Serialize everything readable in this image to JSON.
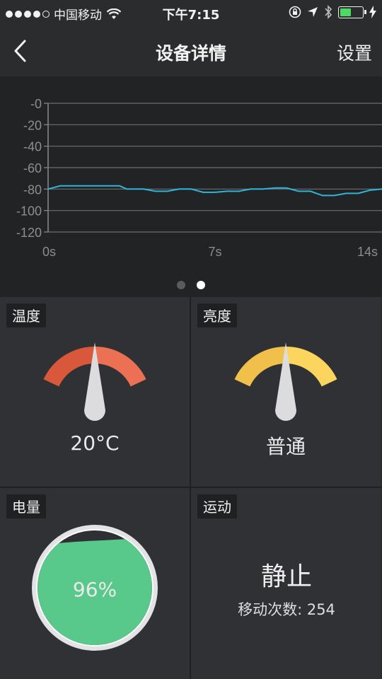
{
  "status_bar": {
    "carrier": "中国移动",
    "time": "下午7:15",
    "signal_dots": 5,
    "signal_filled": 4,
    "battery_level": 0.5,
    "icons": [
      "wifi-icon",
      "rotation-lock-icon",
      "location-arrow-icon",
      "bluetooth-icon",
      "battery-icon",
      "charging-bolt-icon"
    ]
  },
  "nav": {
    "back_icon": "chevron-left-icon",
    "title": "设备详情",
    "settings_label": "设置"
  },
  "chart_data": {
    "type": "line",
    "title": "",
    "xlabel": "",
    "ylabel": "",
    "x_ticks": [
      "0s",
      "7s",
      "14s"
    ],
    "y_ticks": [
      "-0",
      "-20",
      "-40",
      "-60",
      "-80",
      "-100",
      "-120"
    ],
    "xlim": [
      0,
      14
    ],
    "ylim": [
      -120,
      0
    ],
    "grid": true,
    "series": [
      {
        "color": "#2fb6d6",
        "x": [
          0,
          0.5,
          1,
          2,
          3,
          3.3,
          4,
          4.5,
          5,
          5.5,
          6,
          6.5,
          7,
          7.5,
          8,
          8.5,
          9,
          9.5,
          10,
          10.5,
          11,
          11.5,
          12,
          12.5,
          13,
          13.5,
          14
        ],
        "y": [
          -80,
          -77,
          -77,
          -77,
          -77,
          -80,
          -80,
          -82,
          -82,
          -80,
          -80,
          -83,
          -83,
          -82,
          -82,
          -80,
          -80,
          -79,
          -79,
          -82,
          -82,
          -86,
          -86,
          -84,
          -84,
          -81,
          -80
        ]
      }
    ]
  },
  "pager": {
    "count": 2,
    "active_index": 1
  },
  "temperature": {
    "label": "温度",
    "value": "20°C",
    "colors": {
      "left": "#d9583b",
      "right": "#ec7054"
    },
    "needle_level": 0.5
  },
  "brightness": {
    "label": "亮度",
    "value": "普通",
    "colors": {
      "left": "#f0c04a",
      "right": "#fbd55e"
    },
    "needle_level": 0.5
  },
  "power": {
    "label": "电量",
    "percent_text": "96%",
    "level": 0.96,
    "colors": {
      "fill": "#58c98a",
      "ring": "#e3e3e5"
    }
  },
  "motion": {
    "label": "运动",
    "state": "静止",
    "count_text": "移动次数: 254"
  }
}
